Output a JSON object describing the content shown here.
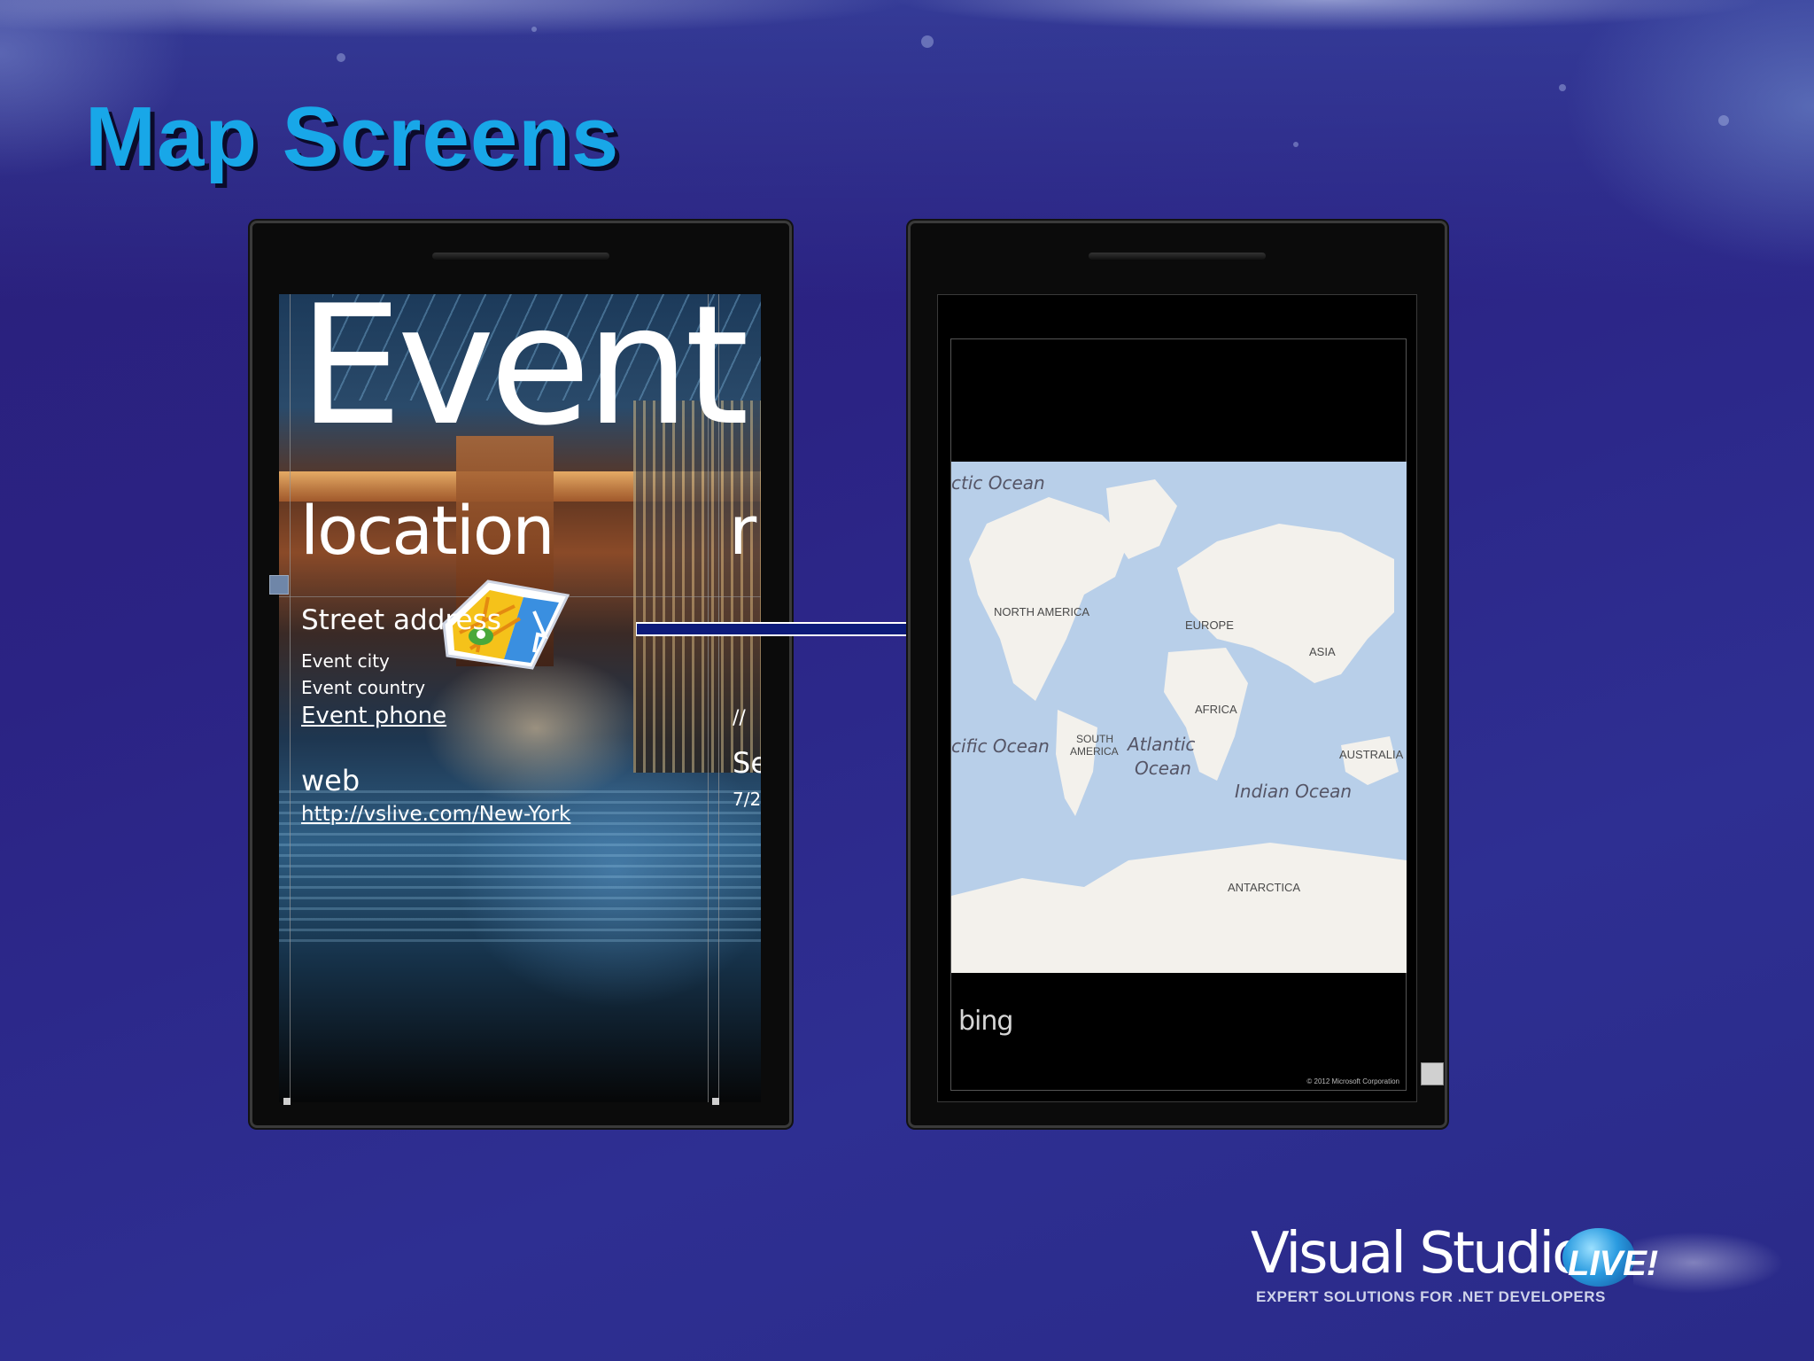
{
  "slide": {
    "title": "Map Screens",
    "title_color": "#18a7e8",
    "background_color": "#2b2384"
  },
  "event_screen": {
    "title": "Event",
    "subtitle": "location",
    "subtitle_next_fragment": "r",
    "street_address": "Street address",
    "city": "Event city",
    "country": "Event country",
    "phone": "Event phone",
    "web_label": "web",
    "web_url": "http://vslive.com/New-York",
    "side_fragments": [
      "//",
      "Se",
      "7/2"
    ],
    "map_icon": "map-app-icon"
  },
  "map_screen": {
    "continents": [
      "NORTH AMERICA",
      "EUROPE",
      "ASIA",
      "AFRICA",
      "SOUTH",
      "AMERICA",
      "AUSTRALIA",
      "ANTARCTICA"
    ],
    "oceans": [
      "ctic Ocean",
      "cific Ocean",
      "Atlantic",
      "Ocean",
      "Indian Ocean"
    ],
    "provider_logo": "bing",
    "copyright": "© 2012 Microsoft Corporation",
    "water_color": "#b8cfe9",
    "land_color": "#f3f1ec"
  },
  "arrow": {
    "color": "#0d1b7a"
  },
  "logo": {
    "wordmark": "Visual Studio",
    "badge": "LIVE!",
    "tagline": "EXPERT SOLUTIONS FOR .NET DEVELOPERS"
  }
}
